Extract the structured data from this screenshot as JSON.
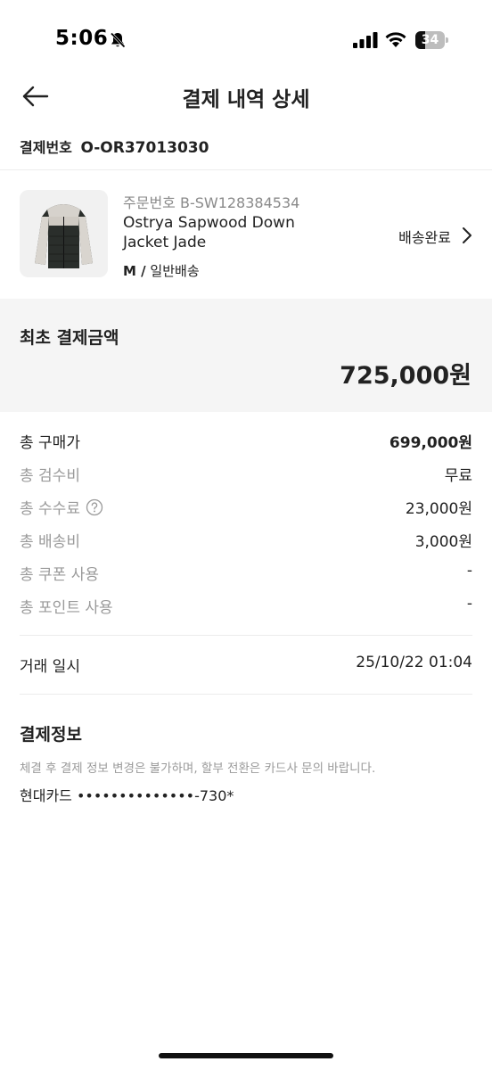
{
  "status_bar": {
    "time": "5:06",
    "battery_level": "34",
    "battery_fraction": 0.34
  },
  "header": {
    "title": "결제 내역 상세",
    "back_icon": "arrow-left-icon"
  },
  "payment": {
    "number_label": "결제번호",
    "number_value": "O-OR37013030"
  },
  "product": {
    "order_number": "주문번호 B-SW128384534",
    "name": "Ostrya Sapwood Down Jacket Jade",
    "option_size": "M /",
    "option_shipping": "일반배송",
    "status": "배송완료",
    "image_icon": "down-jacket-image"
  },
  "initial_total": {
    "label": "최초 결제금액",
    "amount": "725,000원"
  },
  "breakdown": {
    "purchase_label": "총 구매가",
    "purchase_value": "699,000원",
    "inspection_label": "총 검수비",
    "inspection_value": "무료",
    "fee_label": "총 수수료",
    "fee_value": "23,000원",
    "shipping_label": "총 배송비",
    "shipping_value": "3,000원",
    "coupon_label": "총 쿠폰 사용",
    "coupon_value": "-",
    "points_label": "총 포인트 사용",
    "points_value": "-"
  },
  "transaction": {
    "date_label": "거래 일시",
    "date_value": "25/10/22 01:04"
  },
  "payment_info": {
    "title": "결제정보",
    "notice": "체결 후 결제 정보 변경은 불가하며, 할부 전환은 카드사 문의 바랍니다.",
    "card": "현대카드 ••••••••••••••-730*"
  },
  "colors": {
    "text_primary": "#222222",
    "text_secondary": "#9a9a9a",
    "highlight_background": "#f5f5f5",
    "divider": "#ececec"
  }
}
